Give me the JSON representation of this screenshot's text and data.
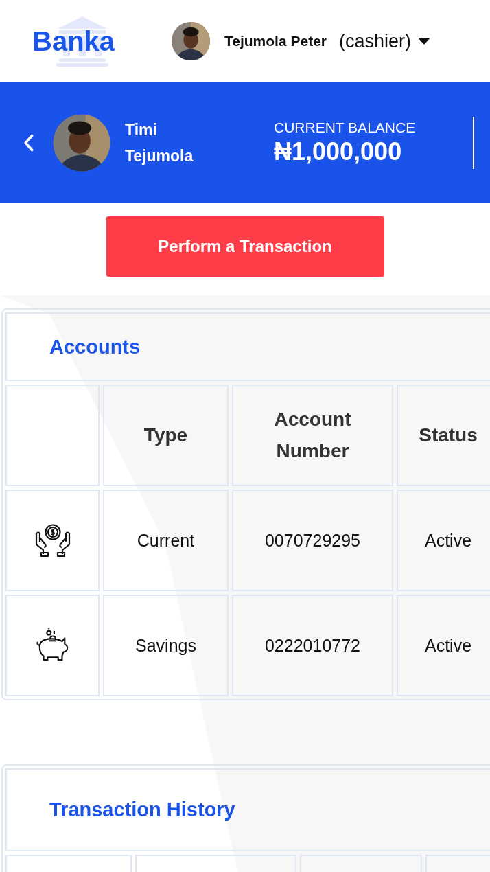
{
  "header": {
    "logo": "Banka",
    "user": {
      "name": "Tejumola Peter",
      "role": "(cashier)"
    }
  },
  "customer": {
    "name": "Timi Tejumola",
    "balance_label": "CURRENT BALANCE",
    "balance": "₦1,000,000"
  },
  "action_button": "Perform a Transaction",
  "accounts": {
    "title": "Accounts",
    "columns": [
      "Type",
      "Account Number",
      "Status"
    ],
    "rows": [
      {
        "kind": "current",
        "type": "Current",
        "number": "0070729295",
        "status": "Active"
      },
      {
        "kind": "savings",
        "type": "Savings",
        "number": "0222010772",
        "status": "Active"
      }
    ]
  },
  "transaction_history": {
    "title": "Transaction History"
  }
}
